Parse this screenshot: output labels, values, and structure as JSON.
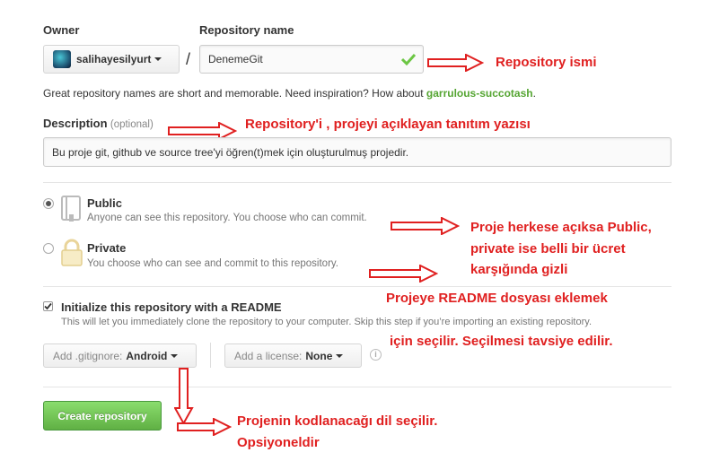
{
  "owner": {
    "label": "Owner",
    "selected": "salihayesilyurt"
  },
  "repo": {
    "label": "Repository name",
    "value": "DenemeGit"
  },
  "separator": "/",
  "hint": {
    "prefix": "Great repository names are short and memorable. Need inspiration? How about ",
    "suggestion": "garrulous-succotash",
    "suffix": "."
  },
  "description": {
    "label": "Description",
    "optional": "(optional)",
    "value": "Bu proje git, github ve source tree'yi öğren(t)mek için oluşturulmuş projedir."
  },
  "visibility": {
    "public": {
      "title": "Public",
      "desc": "Anyone can see this repository. You choose who can commit."
    },
    "private": {
      "title": "Private",
      "desc": "You choose who can see and commit to this repository."
    }
  },
  "readme": {
    "title": "Initialize this repository with a README",
    "desc": "This will let you immediately clone the repository to your computer. Skip this step if you’re importing an existing repository."
  },
  "gitignore": {
    "label": "Add .gitignore:",
    "value": "Android"
  },
  "license": {
    "label": "Add a license:",
    "value": "None"
  },
  "create_button": "Create repository",
  "annotations": {
    "repo_name": "Repository ismi",
    "description": "Repository'i , projeyi açıklayan tanıtım yazısı",
    "visibility_1": "Proje herkese açıksa Public,",
    "visibility_2": "private ise belli bir ücret",
    "visibility_3": "karşığında gizli",
    "readme_1": "Projeye README dosyası eklemek",
    "readme_2": "için seçilir. Seçilmesi tavsiye edilir.",
    "gitignore_1": "Projenin kodlanacağı dil seçilir.",
    "gitignore_2": "Opsiyoneldir"
  },
  "colors": {
    "accent_red": "#e02020",
    "success_green": "#6cc644",
    "button_green": "#60b044"
  }
}
